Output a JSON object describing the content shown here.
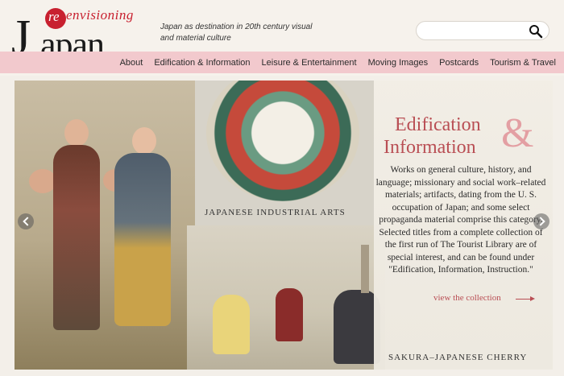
{
  "header": {
    "logo": {
      "prefix": "re",
      "top_word": "envisioning",
      "main_word": "Japan"
    },
    "tagline": "Japan as destination in 20th century visual and material culture"
  },
  "search": {
    "placeholder": "",
    "icon": "search-icon"
  },
  "nav": {
    "items": [
      "About",
      "Edification & Information",
      "Leisure & Entertainment",
      "Moving Images",
      "Postcards",
      "Tourism & Travel"
    ]
  },
  "hero": {
    "title_line1": "Edification",
    "title_amp": "&",
    "title_line2": "Information",
    "description": "Works on general culture, history, and language; missionary and social work–related materials; artifacts, dating from the U. S. occupation of Japan; and some select propaganda material comprise this category. Selected titles from a complete collection of the first run of The Tourist Library are of special interest, and can be found under \"Edification, Information, Instruction.\"",
    "link": "view the collection",
    "image_caption_top": "JAPANESE INDUSTRIAL ARTS",
    "image_caption_bottom": "SAKURA–JAPANESE CHERRY"
  },
  "colors": {
    "accent": "#b94e54",
    "nav_bg": "#f2c9cd",
    "logo_red": "#c8202f"
  }
}
